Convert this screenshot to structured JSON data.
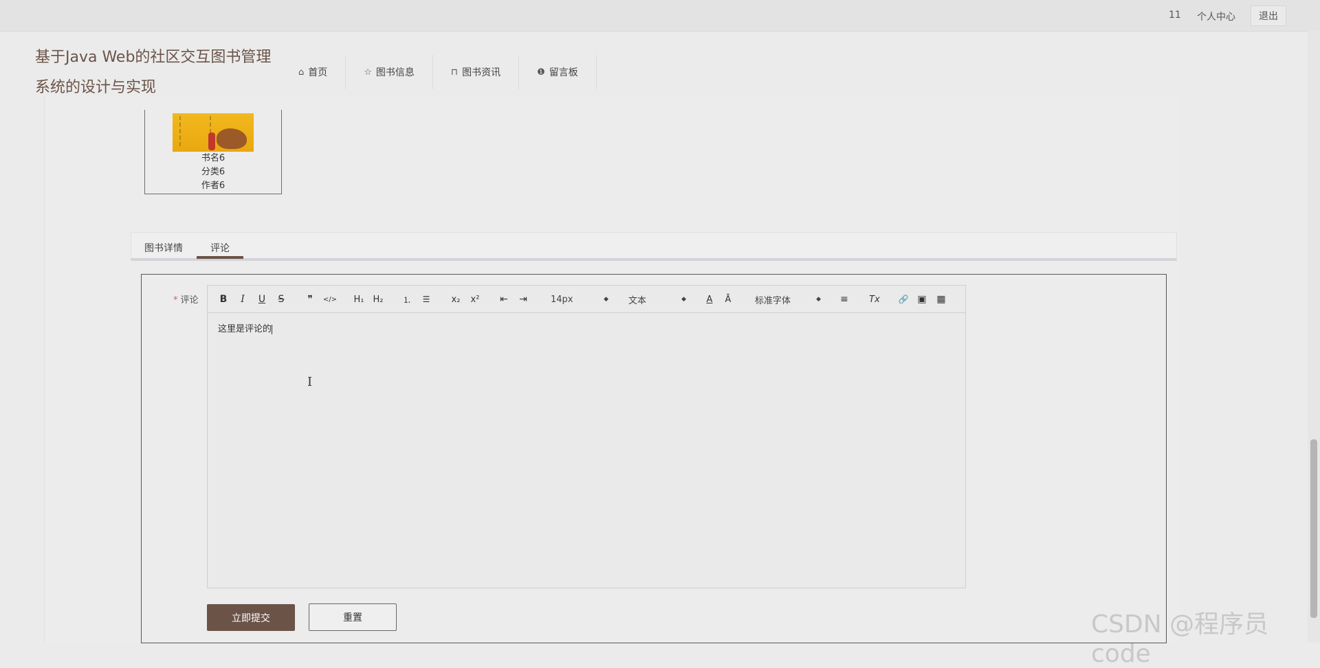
{
  "topbar": {
    "user_id": "11",
    "personal_center": "个人中心",
    "logout": "退出"
  },
  "site": {
    "title": "基于Java Web的社区交互图书管理系统的设计与实现"
  },
  "nav": {
    "items": [
      {
        "label": "首页",
        "icon": "home-icon"
      },
      {
        "label": "图书信息",
        "icon": "star-icon"
      },
      {
        "label": "图书资讯",
        "icon": "bag-icon"
      },
      {
        "label": "留言板",
        "icon": "exclamation-icon"
      }
    ]
  },
  "book": {
    "name": "书名6",
    "category": "分类6",
    "author": "作者6"
  },
  "tabs": {
    "details": "图书详情",
    "comments": "评论",
    "active": "评论"
  },
  "form": {
    "required_mark": "*",
    "label": "评论",
    "content": "这里是评论的",
    "submit": "立即提交",
    "reset": "重置"
  },
  "toolbar": {
    "bold": "B",
    "italic": "I",
    "underline": "U",
    "strike": "S",
    "quote": "❞",
    "code": "</>",
    "h1": "H₁",
    "h2": "H₂",
    "ordered_list": "⒈",
    "bullet_list": "☰",
    "subscript": "x₂",
    "superscript": "x²",
    "outdent": "⇤",
    "indent": "⇥",
    "size": "14px",
    "header": "文本",
    "color": "A",
    "background": "Ā",
    "font": "标准字体",
    "align": "≡",
    "clean": "Tx",
    "link": "🔗",
    "image": "▣",
    "video": "▦"
  },
  "watermark": "CSDN @程序员code"
}
